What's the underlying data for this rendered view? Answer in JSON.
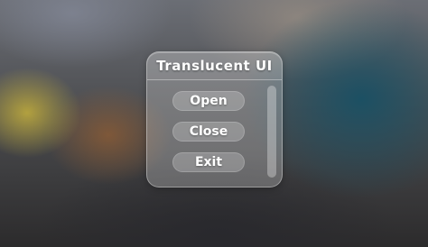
{
  "window": {
    "title": "Translucent UI"
  },
  "menu": {
    "items": [
      {
        "label": "Open"
      },
      {
        "label": "Close"
      },
      {
        "label": "Exit"
      }
    ]
  },
  "scrollbar": {
    "thumb_fraction": 1.0,
    "position": 0.0
  },
  "colors": {
    "panel": "#E6E6E6",
    "text": "#FFFFFF",
    "background_dark": "#2C2B2C",
    "background_blue": "#195064",
    "background_yellow": "#C4AF3C"
  }
}
